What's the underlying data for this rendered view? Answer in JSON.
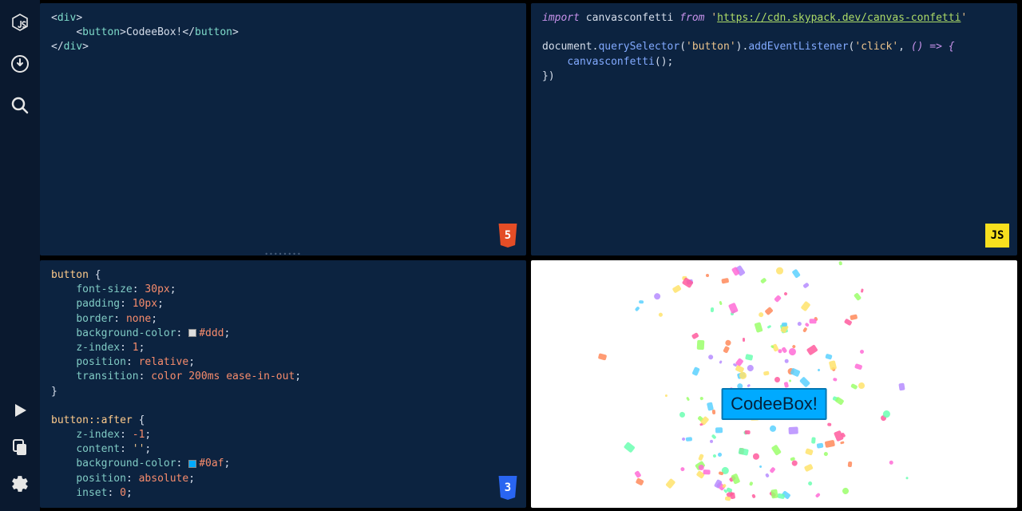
{
  "sidebar": {
    "icons_top": [
      "js-logo",
      "download",
      "search"
    ],
    "icons_bottom": [
      "play",
      "copy",
      "settings"
    ]
  },
  "panes": {
    "html": {
      "badge": "5",
      "code": {
        "l1_open": "<div>",
        "l2_open": "<button>",
        "l2_text": "CodeeBox!",
        "l2_close": "</button>",
        "l3_close": "</div>"
      }
    },
    "js": {
      "badge": "JS",
      "code": {
        "import_kw": "import",
        "import_ident": "canvasconfetti",
        "from_kw": "from",
        "import_url": "https://cdn.skypack.dev/canvas-confetti",
        "doc": "document",
        "qs": "querySelector",
        "qs_arg": "button",
        "ael": "addEventListener",
        "ael_arg": "click",
        "arrow": "() => {",
        "call": "canvasconfetti",
        "close": "})"
      }
    },
    "css": {
      "badge": "3",
      "code": {
        "sel1": "button",
        "p1": "font-size",
        "v1": "30px",
        "p2": "padding",
        "v2": "10px",
        "p3": "border",
        "v3": "none",
        "p4": "background-color",
        "v4": "#ddd",
        "p5": "z-index",
        "v5": "1",
        "p6": "position",
        "v6": "relative",
        "p7": "transition",
        "v7a": "color",
        "v7b": "200ms",
        "v7c": "ease-in-out",
        "sel2": "button::after",
        "p8": "z-index",
        "v8": "-1",
        "p9": "content",
        "v9": "''",
        "p10": "background-color",
        "v10": "#0af",
        "p11": "position",
        "v11": "absolute",
        "p12": "inset",
        "v12": "0"
      }
    },
    "preview": {
      "button_label": "CodeeBox!"
    }
  },
  "colors": {
    "swatch_ddd": "#dddddd",
    "swatch_0af": "#00aaff"
  },
  "confetti_colors": [
    "#ff6bd6",
    "#5ad1ff",
    "#9bff6b",
    "#ffe36b",
    "#ff8a5a",
    "#b68cff",
    "#6bffb2",
    "#ff5a9e"
  ]
}
